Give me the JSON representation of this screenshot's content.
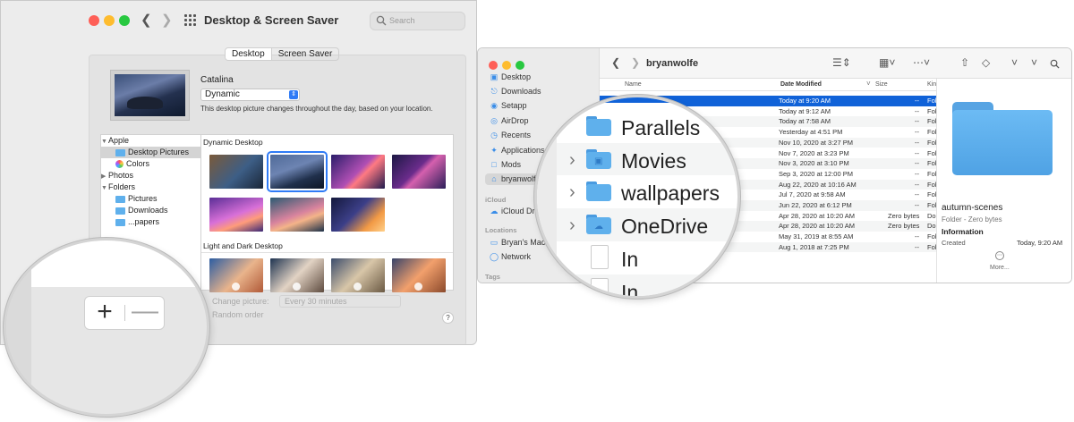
{
  "prefs": {
    "title": "Desktop & Screen Saver",
    "search_placeholder": "Search",
    "tabs": [
      "Desktop",
      "Screen Saver"
    ],
    "picture_name": "Catalina",
    "picture_mode": "Dynamic",
    "picture_description": "This desktop picture changes throughout the day, based on your location.",
    "sidebar": {
      "apple": "Apple",
      "desktop_pictures": "Desktop Pictures",
      "colors": "Colors",
      "photos": "Photos",
      "folders": "Folders",
      "pictures": "Pictures",
      "downloads": "Downloads",
      "partial": "...papers"
    },
    "sections": [
      "Dynamic Desktop",
      "Light and Dark Desktop"
    ],
    "change_picture_label": "Change picture:",
    "change_picture_value": "Every 30 minutes",
    "random_order_label": "Random order",
    "help": "?",
    "magnifier": {
      "add": "+",
      "remove": "—"
    }
  },
  "finder": {
    "title": "bryanwolfe",
    "sidebar": [
      {
        "label": "Desktop",
        "icon": "desktop-icon"
      },
      {
        "label": "Downloads",
        "icon": "downloads-icon"
      },
      {
        "label": "Setapp",
        "icon": "setapp-icon"
      },
      {
        "label": "AirDrop",
        "icon": "airdrop-icon"
      },
      {
        "label": "Recents",
        "icon": "recents-icon"
      },
      {
        "label": "Applications",
        "icon": "applications-icon"
      },
      {
        "label": "Mods",
        "icon": "folder-icon"
      },
      {
        "label": "bryanwolfe",
        "icon": "home-icon"
      }
    ],
    "icloud_header": "iCloud",
    "icloud_drive": "iCloud Drive",
    "locations_header": "Locations",
    "bryans_mac": "Bryan's Mac",
    "network": "Network",
    "tags_header": "Tags",
    "columns": {
      "name": "Name",
      "date": "Date Modified",
      "size": "Size",
      "kind": "Kind"
    },
    "rows": [
      {
        "date": "Today at 9:20 AM",
        "size": "--",
        "kind": "Fol"
      },
      {
        "date": "Today at 9:12 AM",
        "size": "--",
        "kind": "Fol"
      },
      {
        "date": "Today at 7:58 AM",
        "size": "--",
        "kind": "Fol"
      },
      {
        "date": "Yesterday at 4:51 PM",
        "size": "--",
        "kind": "Fol"
      },
      {
        "date": "Nov 10, 2020 at 3:27 PM",
        "size": "--",
        "kind": "Fol"
      },
      {
        "date": "Nov 7, 2020 at 3:23 PM",
        "size": "--",
        "kind": "Fol"
      },
      {
        "date": "Nov 3, 2020 at 3:10 PM",
        "size": "--",
        "kind": "Fol"
      },
      {
        "date": "Sep 3, 2020 at 12:00 PM",
        "size": "--",
        "kind": "Fol"
      },
      {
        "date": "Aug 22, 2020 at 10:16 AM",
        "size": "--",
        "kind": "Fol"
      },
      {
        "date": "Jul 7, 2020 at 9:58 AM",
        "size": "--",
        "kind": "Fol"
      },
      {
        "date": "Jun 22, 2020 at 6:12 PM",
        "size": "--",
        "kind": "Fol"
      },
      {
        "date": "Apr 28, 2020 at 10:20 AM",
        "size": "Zero bytes",
        "kind": "Do"
      },
      {
        "date": "Apr 28, 2020 at 10:20 AM",
        "size": "Zero bytes",
        "kind": "Do"
      },
      {
        "date": "May 31, 2019 at 8:55 AM",
        "size": "--",
        "kind": "Fol"
      },
      {
        "date": "Aug 1, 2018 at 7:25 PM",
        "size": "--",
        "kind": "Fol"
      }
    ],
    "preview": {
      "name": "autumn-scenes",
      "kind": "Folder - Zero bytes",
      "info": "Information",
      "created_label": "Created",
      "created_value": "Today, 9:20 AM",
      "more": "More..."
    },
    "magnifier_items": [
      "Parallels",
      "Movies",
      "wallpapers",
      "OneDrive",
      "In",
      "In"
    ]
  }
}
